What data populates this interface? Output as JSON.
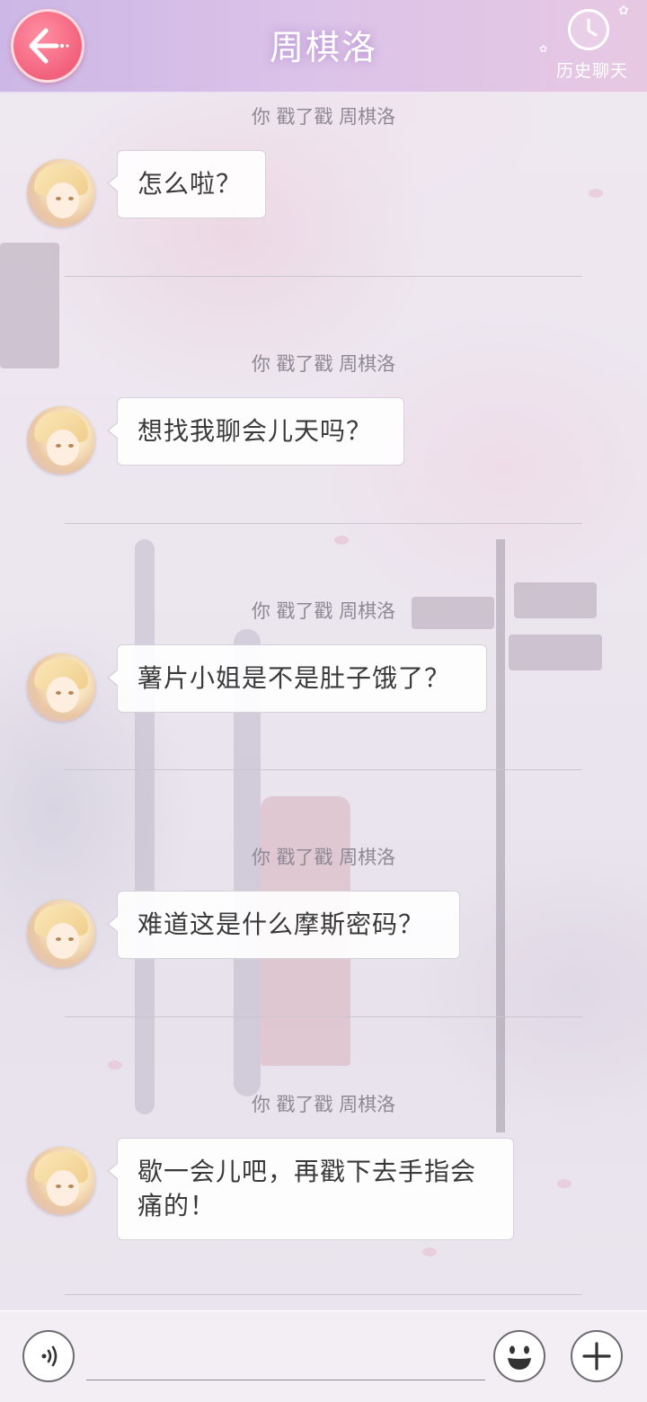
{
  "header": {
    "title": "周棋洛",
    "back_icon": "back-arrow-icon",
    "history_label": "历史聊天",
    "history_icon": "clock-icon",
    "accent_color": "#f2617c"
  },
  "chat": {
    "messages": [
      {
        "notice": "你 戳了戳 周棋洛",
        "text": "怎么啦？"
      },
      {
        "notice": "你 戳了戳 周棋洛",
        "text": "想找我聊会儿天吗？"
      },
      {
        "notice": "你 戳了戳 周棋洛",
        "text": "薯片小姐是不是肚子饿了？"
      },
      {
        "notice": "你 戳了戳 周棋洛",
        "text": "难道这是什么摩斯密码？"
      },
      {
        "notice": "你 戳了戳 周棋洛",
        "text": "歇一会儿吧，再戳下去手指会痛的！"
      }
    ]
  },
  "input_bar": {
    "voice_icon": "voice-icon",
    "emoji_icon": "emoji-icon",
    "plus_icon": "plus-icon",
    "message_value": ""
  }
}
